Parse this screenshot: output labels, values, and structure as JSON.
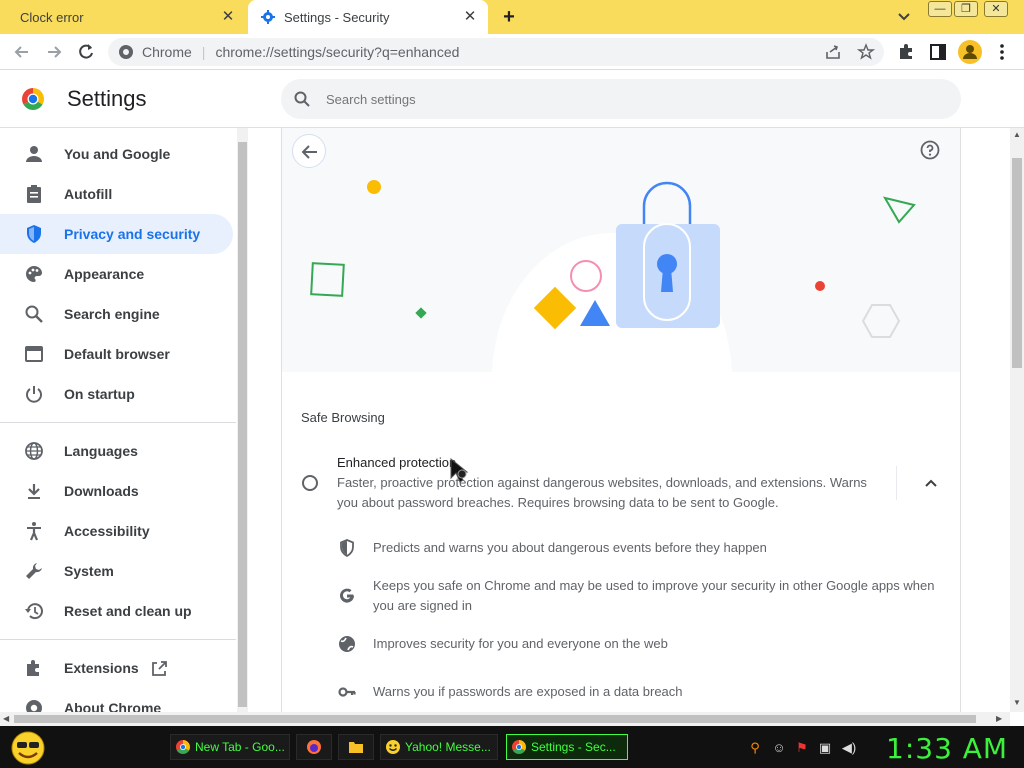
{
  "browser": {
    "tabs": [
      {
        "title": "Clock error",
        "active": false
      },
      {
        "title": "Settings - Security",
        "active": true
      }
    ],
    "omnibox": {
      "site_label": "Chrome",
      "url": "chrome://settings/security?q=enhanced"
    }
  },
  "settings": {
    "title": "Settings",
    "search_placeholder": "Search settings",
    "nav_items": [
      {
        "label": "You and Google",
        "icon": "person-icon"
      },
      {
        "label": "Autofill",
        "icon": "clipboard-icon"
      },
      {
        "label": "Privacy and security",
        "icon": "shield-icon",
        "selected": true
      },
      {
        "label": "Appearance",
        "icon": "palette-icon"
      },
      {
        "label": "Search engine",
        "icon": "search-icon"
      },
      {
        "label": "Default browser",
        "icon": "browser-icon"
      },
      {
        "label": "On startup",
        "icon": "power-icon"
      },
      {
        "label": "Languages",
        "icon": "globe-icon"
      },
      {
        "label": "Downloads",
        "icon": "download-icon"
      },
      {
        "label": "Accessibility",
        "icon": "accessibility-icon"
      },
      {
        "label": "System",
        "icon": "wrench-icon"
      },
      {
        "label": "Reset and clean up",
        "icon": "history-icon"
      },
      {
        "label": "Extensions",
        "icon": "puzzle-icon"
      },
      {
        "label": "About Chrome",
        "icon": "chrome-icon"
      }
    ],
    "safe_browsing": {
      "section_title": "Safe Browsing",
      "option_title": "Enhanced protection",
      "option_description": "Faster, proactive protection against dangerous websites, downloads, and extensions. Warns you about password breaches. Requires browsing data to be sent to Google.",
      "selected": false,
      "expanded": true,
      "features": [
        {
          "icon": "shield-icon",
          "text": "Predicts and warns you about dangerous events before they happen"
        },
        {
          "icon": "google-g-icon",
          "text": "Keeps you safe on Chrome and may be used to improve your security in other Google apps when you are signed in"
        },
        {
          "icon": "globe-icon",
          "text": "Improves security for you and everyone on the web"
        },
        {
          "icon": "key-icon",
          "text": "Warns you if passwords are exposed in a data breach"
        }
      ]
    }
  },
  "taskbar": {
    "tasks": [
      {
        "title": "New Tab - Goo...",
        "icon": "chrome-icon",
        "active": false
      },
      {
        "title": "",
        "icon": "firefox-icon",
        "active": false
      },
      {
        "title": "",
        "icon": "folder-icon",
        "active": false
      },
      {
        "title": "Yahoo! Messe...",
        "icon": "yahoo-messenger-icon",
        "active": false
      },
      {
        "title": "Settings - Sec...",
        "icon": "chrome-icon",
        "active": true
      }
    ],
    "clock": "1:33 AM"
  },
  "colors": {
    "accent": "#1a73e8",
    "tabstrip": "#f9dc5c",
    "selected_nav_bg": "#e8f0fe",
    "taskbar_text": "#40ff40"
  }
}
